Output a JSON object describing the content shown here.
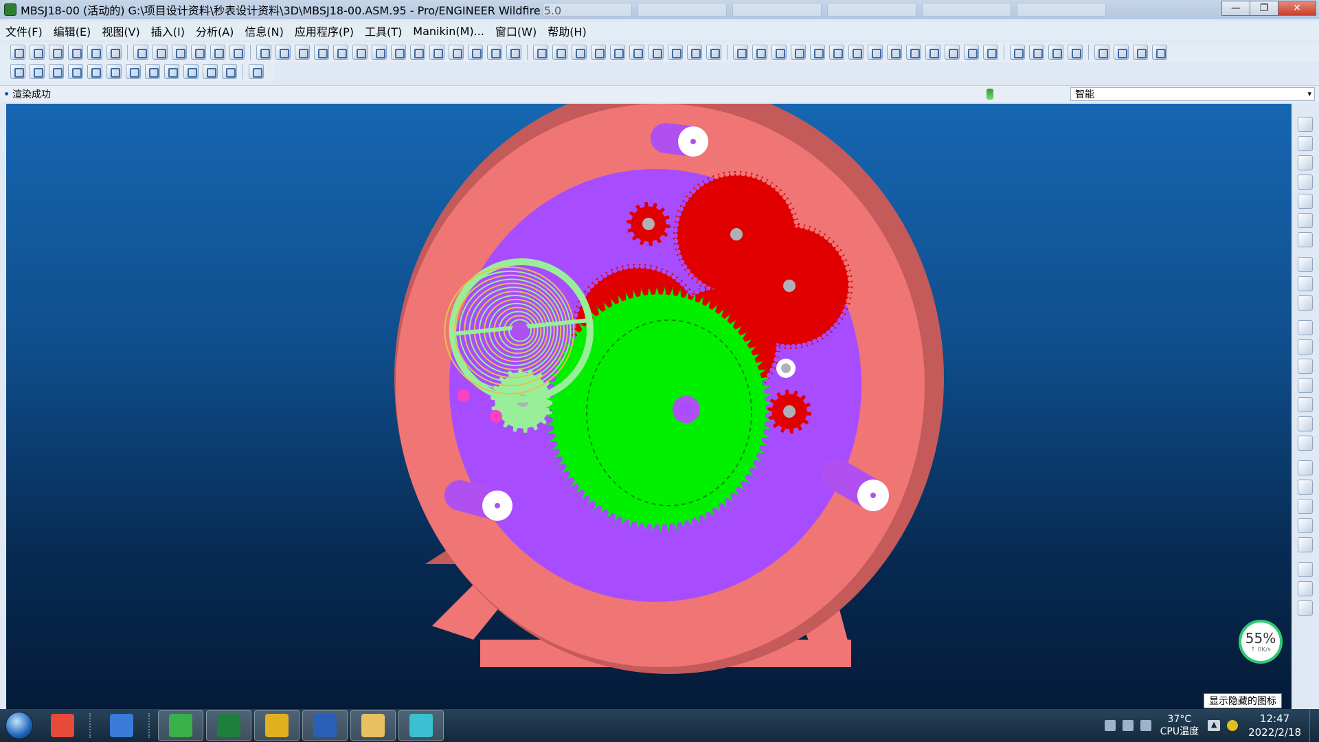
{
  "window": {
    "title": "MBSJ18-00 (活动的) G:\\项目设计资料\\秒表设计资料\\3D\\MBSJ18-00.ASM.95 - Pro/ENGINEER Wildfire 5.0",
    "minimize": "—",
    "maximize": "❐",
    "close": "✕"
  },
  "menubar": [
    "文件(F)",
    "编辑(E)",
    "视图(V)",
    "插入(I)",
    "分析(A)",
    "信息(N)",
    "应用程序(P)",
    "工具(T)",
    "Manikin(M)...",
    "窗口(W)",
    "帮助(H)"
  ],
  "toolbar": {
    "row1_icons": [
      "new-assembly-icon",
      "regenerate-icon",
      "assembly-tree-icon",
      "component-icon",
      "package-icon",
      "placement-icon",
      "new-file-icon",
      "open-file-icon",
      "save-icon",
      "print-icon",
      "email-icon",
      "shade-icon",
      "undo-icon",
      "redo-icon",
      "cut-icon",
      "copy-icon",
      "paste-icon",
      "paste-special-icon",
      "mirror-icon",
      "select-box-icon",
      "chamfer-icon",
      "edge-icon",
      "pattern-icon",
      "table-icon",
      "curves-icon",
      "stack-icon",
      "datum-plane-icon",
      "datum-axis-icon",
      "datum-point-icon",
      "coord-sys-icon",
      "sketch-icon",
      "trim-icon",
      "model-tree-icon",
      "layer-tree-icon",
      "binoculars-icon",
      "selection-filter-icon",
      "repaint-icon",
      "orient-icon",
      "view-manager-icon",
      "spin-center-icon",
      "appearance-icon",
      "sphere-icon",
      "pan-icon",
      "zoom-in-icon",
      "zoom-out-icon",
      "refit-icon",
      "named-views-icon",
      "saved-views-icon",
      "layers-icon",
      "hidden-icon",
      "wireframe-icon",
      "hidden-line-icon",
      "no-hidden-icon",
      "shading-icon",
      "datum-plane-display-icon",
      "datum-axis-display-icon",
      "point-display-icon",
      "csys-display-icon"
    ],
    "row2_icons": [
      "measure-icon",
      "draft-icon",
      "section-icon",
      "mass-props-icon",
      "curvature-icon",
      "surface-analysis-icon",
      "wave-icon",
      "color-analysis-icon",
      "text-icon",
      "pattern-analysis-icon",
      "measure-distance-icon",
      "rulers-icon",
      "context-help-icon"
    ]
  },
  "messagebar": {
    "message": "渲染成功",
    "filter_value": "智能",
    "filter_chevron": "▾"
  },
  "scene": {
    "background_top": "#1666b1",
    "background_bottom": "#051b38",
    "colors": {
      "frame": "#f07575",
      "frame_dark": "#c55a5a",
      "plate": "#a74dff",
      "gear_red": "#e00000",
      "gear_green": "#00f000",
      "spring_green": "#99ee99",
      "spring_gold": "#e5c050",
      "pin_purple": "#b050f0",
      "hole_white": "#ffffff",
      "arbor_gray": "#b0b0b8"
    }
  },
  "righttoolbar": [
    "sketch-tool-icon",
    "plane-tool-icon",
    "axis-tool-icon",
    "curve-tool-icon",
    "point-tool-icon",
    "csys-tool-icon",
    "analysis-tool-icon",
    "hole-tool-icon",
    "shell-tool-icon",
    "rib-tool-icon",
    "assemble-icon",
    "create-component-icon",
    "pattern-tool-icon",
    "draft-tool-icon",
    "round-tool-icon",
    "chamfer-tool-icon",
    "extrude-icon",
    "revolve-icon",
    "sweep-icon",
    "blend-icon",
    "boundary-icon",
    "mirror-tool-icon",
    "merge-icon",
    "trim-tool-icon",
    "offset-icon"
  ],
  "perf": {
    "percent": "55%",
    "rate": "↑ 0K/s"
  },
  "tooltip": "显示隐藏的图标",
  "taskbar": {
    "apps": [
      "multicolor-app-icon",
      "network-app-icon",
      "browser-green-icon",
      "excel-icon",
      "chrome-icon",
      "word-icon",
      "file-explorer-icon",
      "proe-icon"
    ],
    "tray": {
      "temperature": "37°C",
      "temp_label": "CPU温度",
      "time": "12:47",
      "date": "2022/2/18",
      "arrow": "▲"
    }
  }
}
